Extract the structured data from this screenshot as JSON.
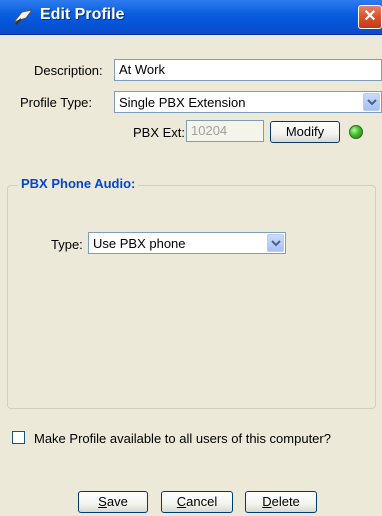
{
  "window": {
    "title": "Edit Profile",
    "close_label": "✕"
  },
  "form": {
    "description_label": "Description:",
    "description_value": "At Work",
    "profile_type_label": "Profile Type:",
    "profile_type_value": "Single PBX Extension",
    "pbx_ext_label": "PBX Ext:",
    "pbx_ext_value": "10204",
    "modify_label": "Modify",
    "extension_status": "online"
  },
  "audio_group": {
    "title": "PBX Phone Audio:",
    "type_label": "Type:",
    "type_value": "Use PBX phone"
  },
  "share": {
    "checkbox_label": "Make Profile available to all users of this computer?",
    "checked": false
  },
  "buttons": {
    "save": {
      "mnemonic": "S",
      "rest": "ave"
    },
    "cancel": {
      "mnemonic": "C",
      "rest": "ancel"
    },
    "delete": {
      "mnemonic": "D",
      "rest": "elete"
    }
  },
  "colors": {
    "titlebar": "#0A5FE0",
    "group_title": "#0046D5",
    "status_led": "#3FBF2A",
    "dialog_bg": "#ECE9D8"
  }
}
